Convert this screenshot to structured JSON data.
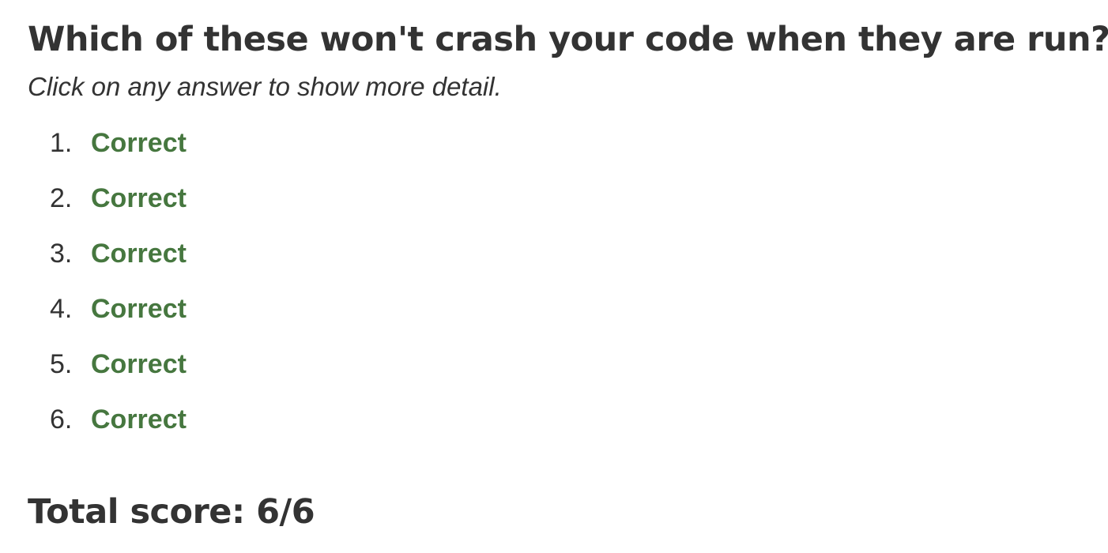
{
  "question": "Which of these won't crash your code when they are run?",
  "instruction": "Click on any answer to show more detail.",
  "answers": [
    {
      "number": "1.",
      "status": "Correct"
    },
    {
      "number": "2.",
      "status": "Correct"
    },
    {
      "number": "3.",
      "status": "Correct"
    },
    {
      "number": "4.",
      "status": "Correct"
    },
    {
      "number": "5.",
      "status": "Correct"
    },
    {
      "number": "6.",
      "status": "Correct"
    }
  ],
  "total": {
    "label": "Total score: 6/6"
  },
  "colors": {
    "text": "#333333",
    "correct": "#46773f",
    "background": "#ffffff"
  }
}
